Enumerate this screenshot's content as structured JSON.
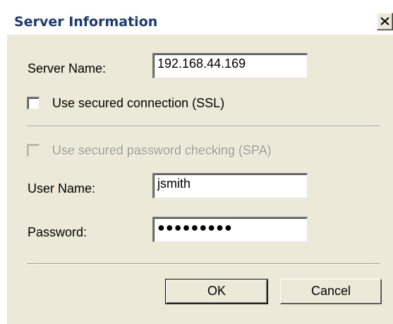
{
  "dialog": {
    "title": "Server Information",
    "close_icon": "close-icon"
  },
  "server": {
    "name_label": "Server Name:",
    "name_value": "192.168.44.169",
    "ssl_label": "Use secured connection (SSL)",
    "ssl_checked": false
  },
  "auth": {
    "spa_label": "Use secured password checking (SPA)",
    "spa_checked": false,
    "spa_enabled": false,
    "username_label": "User Name:",
    "username_value": "jsmith",
    "password_label": "Password:",
    "password_mask": "●●●●●●●●●"
  },
  "buttons": {
    "ok_label": "OK",
    "cancel_label": "Cancel"
  },
  "colors": {
    "face": "#ece9d8",
    "title_text": "#1c3a70",
    "disabled_text": "#9a988c"
  }
}
